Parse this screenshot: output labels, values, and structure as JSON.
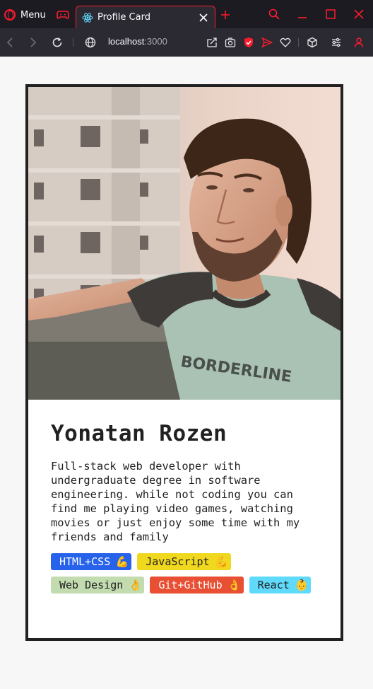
{
  "browser": {
    "menu_label": "Menu",
    "tab_title": "Profile Card",
    "url_host": "localhost",
    "url_port": ":3000",
    "accent_color": "#ff1b2d"
  },
  "profile": {
    "photo_alt": "Yonatan Rozen",
    "name": "Yonatan Rozen",
    "bio": "Full-stack web developer with undergraduate degree in software engineering. while not coding you can find me playing video games, watching movies or just enjoy some time with my friends and family",
    "skills": [
      {
        "label": "HTML+CSS",
        "emoji": "💪",
        "color": "#2662ea",
        "text_color": "#ffffff"
      },
      {
        "label": "JavaScript",
        "emoji": "💪",
        "color": "#efd81d",
        "text_color": "#212121"
      },
      {
        "label": "Web Design",
        "emoji": "👌",
        "color": "#c3dcaf",
        "text_color": "#212121"
      },
      {
        "label": "Git+GitHub",
        "emoji": "👌",
        "color": "#e84f33",
        "text_color": "#ffffff"
      },
      {
        "label": "React",
        "emoji": "👶",
        "color": "#60dafb",
        "text_color": "#212121"
      }
    ]
  }
}
